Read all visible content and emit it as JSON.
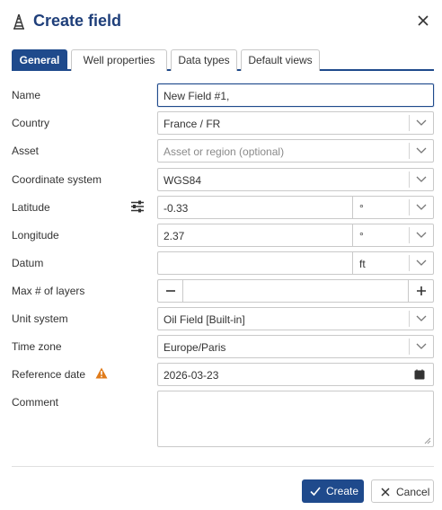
{
  "dialog": {
    "title": "Create field",
    "close_icon": "close-icon",
    "app_icon": "oil-derrick-icon"
  },
  "tabs": [
    {
      "label": "General",
      "active": true
    },
    {
      "label": "Well properties",
      "active": false
    },
    {
      "label": "Data types",
      "active": false
    },
    {
      "label": "Default views",
      "active": false
    }
  ],
  "form": {
    "name": {
      "label": "Name",
      "value": "New Field #1,"
    },
    "country": {
      "label": "Country",
      "value": "France / FR"
    },
    "asset": {
      "label": "Asset",
      "placeholder": "Asset or region (optional)"
    },
    "coordinate_system": {
      "label": "Coordinate system",
      "value": "WGS84"
    },
    "latitude": {
      "label": "Latitude",
      "value": "-0.33",
      "unit": "°",
      "settings_icon": "sliders-icon"
    },
    "longitude": {
      "label": "Longitude",
      "value": "2.37",
      "unit": "°"
    },
    "datum": {
      "label": "Datum",
      "value": "",
      "unit": "ft"
    },
    "max_layers": {
      "label": "Max # of layers",
      "value": ""
    },
    "unit_system": {
      "label": "Unit system",
      "value": "Oil Field [Built-in]"
    },
    "time_zone": {
      "label": "Time zone",
      "value": "Europe/Paris"
    },
    "reference_date": {
      "label": "Reference date",
      "value": "2026-03-23",
      "warning_icon": "warning-icon",
      "warning_color": "#e07b1a"
    },
    "comment": {
      "label": "Comment",
      "value": ""
    }
  },
  "actions": {
    "create_label": "Create",
    "cancel_label": "Cancel"
  },
  "colors": {
    "accent": "#1f4a8c",
    "warning": "#e07b1a"
  }
}
